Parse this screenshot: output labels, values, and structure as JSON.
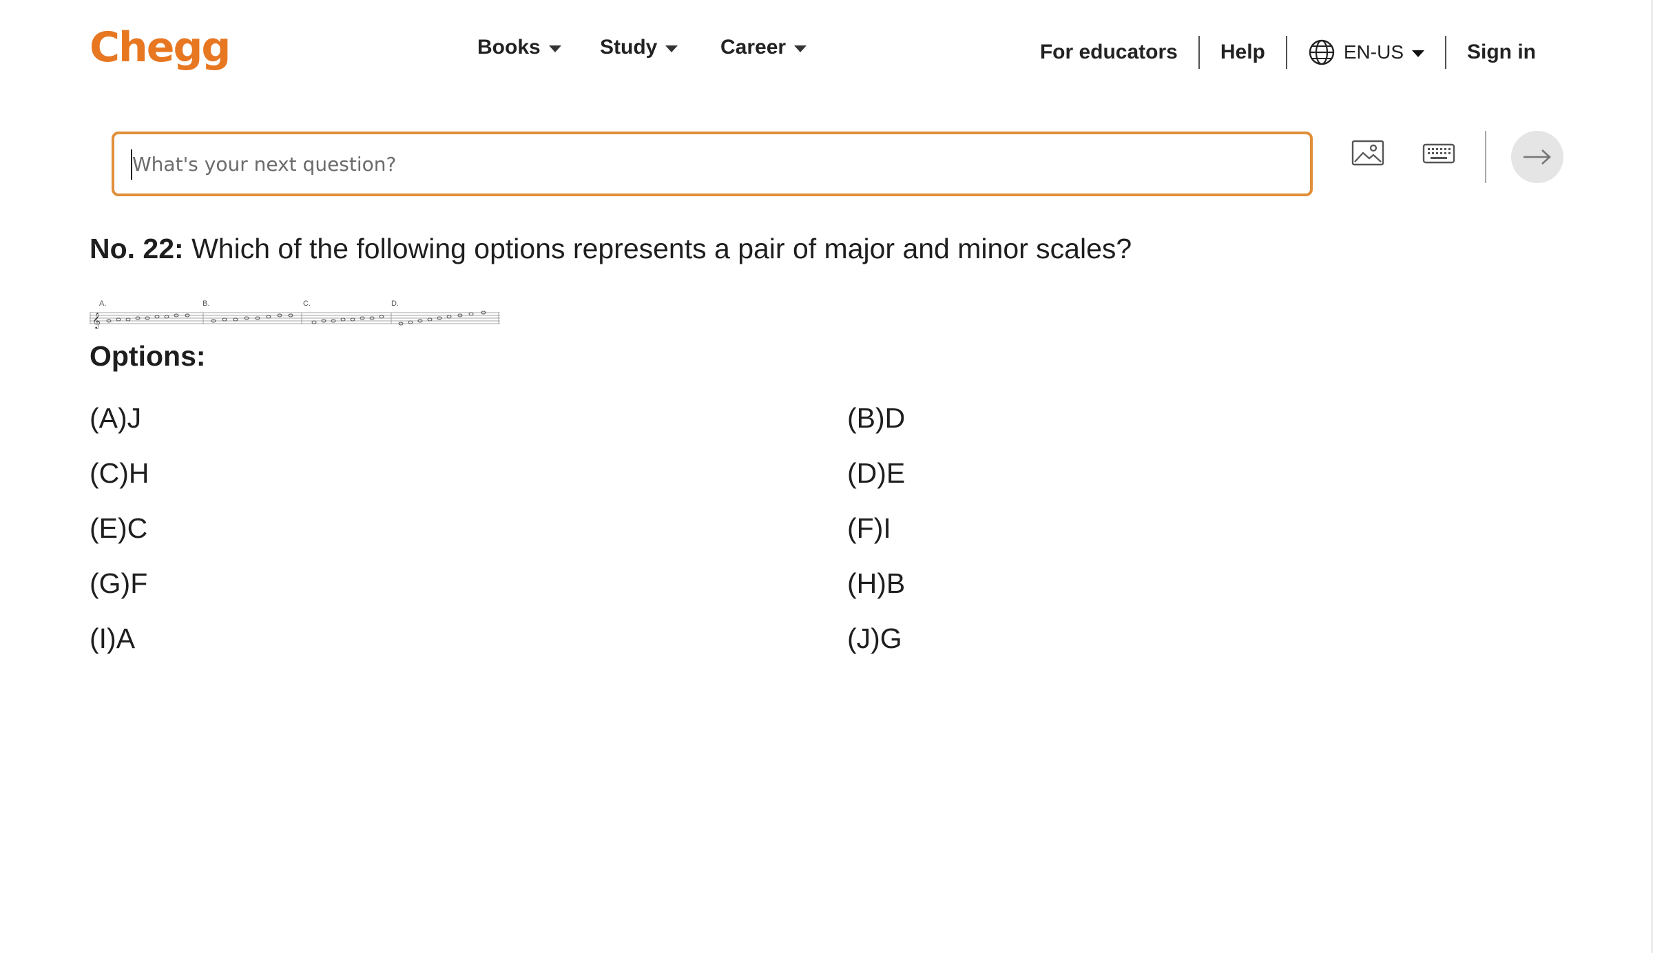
{
  "header": {
    "logo": "Chegg",
    "nav": [
      {
        "label": "Books"
      },
      {
        "label": "Study"
      },
      {
        "label": "Career"
      }
    ],
    "for_educators": "For educators",
    "help": "Help",
    "language": "EN-US",
    "sign_in": "Sign in"
  },
  "search": {
    "placeholder": "What's your next question?",
    "value": ""
  },
  "question": {
    "number_label": "No. 22:",
    "text": "Which of the following options represents a pair of major and minor scales?",
    "image_labels": [
      "A.",
      "B.",
      "C.",
      "D."
    ]
  },
  "options_title": "Options:",
  "options": [
    {
      "label": "(A)J"
    },
    {
      "label": "(B)D"
    },
    {
      "label": "(C)H"
    },
    {
      "label": "(D)E"
    },
    {
      "label": "(E)C"
    },
    {
      "label": "(F)I"
    },
    {
      "label": "(G)F"
    },
    {
      "label": "(H)B"
    },
    {
      "label": "(I)A"
    },
    {
      "label": "(J)G"
    }
  ],
  "colors": {
    "brand": "#e87722",
    "search_border": "#e08f3a",
    "submit_bg": "#e5e5e5"
  },
  "icons": [
    "globe-icon",
    "image-upload-icon",
    "keyboard-icon",
    "arrow-right-icon",
    "chevron-down-icon"
  ]
}
